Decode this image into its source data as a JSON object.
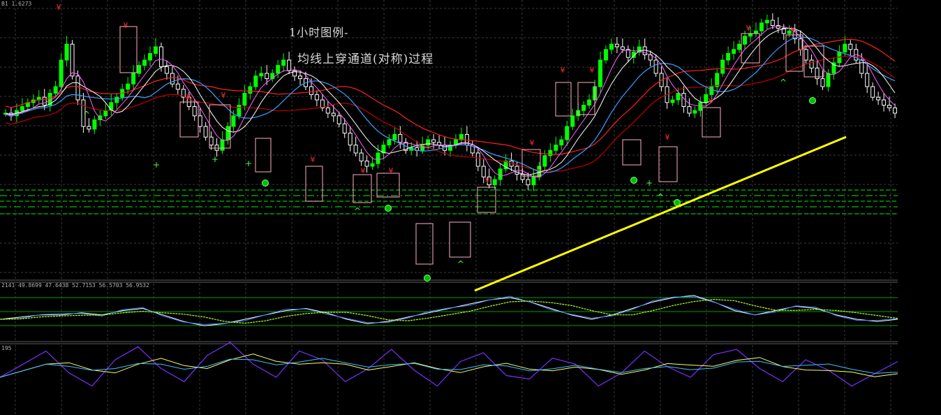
{
  "annotations": {
    "title": "1小时图例-",
    "subtitle": "均线上穿通道(对称)过程"
  },
  "panel_readouts": {
    "main": "B1 1.6273",
    "osc1": "2141 49.8699 47.6438 52.7153 56.5703 56.9532",
    "osc2": "195"
  },
  "colors": {
    "background": "#000000",
    "grid": "#3a3a3a",
    "bull": "#00ff00",
    "bear": "#ffffff",
    "ma_red": "#ff2020",
    "ma_dark_red": "#c00000",
    "ma_blue": "#3aa0ff",
    "ma_white": "#ffffff",
    "ma_pink": "#ff60ff",
    "ma_yellow": "#ffff60",
    "level_green": "#00c000",
    "trendline": "#ffff00",
    "osc_purple": "#7a30ff",
    "osc_yellow": "#ffff66",
    "osc_cyan": "#40c0ff"
  },
  "chart_data": [
    {
      "type": "candlestick",
      "panel": "price",
      "x": [
        0,
        1,
        2,
        3,
        4,
        5,
        6,
        7,
        8,
        9,
        10,
        11,
        12,
        13,
        14,
        15,
        16,
        17,
        18,
        19,
        20,
        21,
        22,
        23,
        24,
        25,
        26,
        27,
        28,
        29,
        30,
        31,
        32,
        33,
        34,
        35,
        36,
        37,
        38,
        39,
        40,
        41,
        42,
        43,
        44,
        45,
        46,
        47,
        48,
        49,
        50,
        51,
        52,
        53,
        54,
        55,
        56,
        57,
        58,
        59,
        60,
        61,
        62,
        63,
        64,
        65,
        66,
        67,
        68,
        69,
        70,
        71,
        72,
        73,
        74,
        75,
        76,
        77,
        78,
        79,
        80,
        81,
        82,
        83,
        84,
        85,
        86,
        87,
        88,
        89,
        90,
        91,
        92,
        93,
        94,
        95,
        96,
        97,
        98,
        99,
        100,
        101,
        102,
        103,
        104,
        105,
        106,
        107,
        108,
        109,
        110,
        111,
        112,
        113,
        114,
        115,
        116,
        117,
        118,
        119,
        120,
        121,
        122,
        123,
        124,
        125,
        126,
        127,
        128,
        129,
        130,
        131,
        132,
        133,
        134,
        135,
        136,
        137,
        138,
        139,
        140,
        141,
        142,
        143,
        144,
        145,
        146,
        147,
        148,
        149,
        150,
        151,
        152,
        153,
        154,
        155,
        156,
        157,
        158,
        159,
        160
      ],
      "close": [
        120,
        118,
        122,
        125,
        128,
        130,
        132,
        126,
        135,
        140,
        160,
        172,
        148,
        130,
        110,
        108,
        115,
        118,
        122,
        128,
        132,
        138,
        142,
        150,
        156,
        160,
        165,
        170,
        155,
        150,
        142,
        138,
        132,
        125,
        118,
        110,
        102,
        96,
        92,
        100,
        110,
        118,
        126,
        135,
        140,
        148,
        150,
        146,
        150,
        156,
        160,
        152,
        148,
        146,
        140,
        134,
        130,
        124,
        120,
        118,
        112,
        105,
        96,
        90,
        84,
        80,
        82,
        90,
        96,
        100,
        104,
        98,
        92,
        94,
        92,
        96,
        100,
        98,
        96,
        92,
        96,
        100,
        104,
        96,
        90,
        80,
        72,
        66,
        70,
        78,
        84,
        80,
        74,
        70,
        66,
        72,
        80,
        88,
        92,
        96,
        100,
        110,
        118,
        122,
        126,
        130,
        140,
        160,
        168,
        172,
        170,
        168,
        162,
        166,
        170,
        164,
        160,
        150,
        140,
        128,
        130,
        135,
        125,
        120,
        122,
        128,
        134,
        140,
        150,
        160,
        165,
        168,
        172,
        178,
        180,
        182,
        188,
        190,
        186,
        184,
        180,
        182,
        176,
        168,
        160,
        154,
        146,
        140,
        150,
        158,
        166,
        172,
        168,
        160,
        150,
        140,
        132,
        130,
        126,
        124,
        120
      ]
    },
    {
      "type": "line",
      "panel": "oscillator-1",
      "series": [
        {
          "values": [
            50,
            51,
            52,
            52,
            53,
            52,
            54,
            55,
            52,
            49,
            47,
            48,
            50,
            52,
            54,
            55,
            53,
            50,
            48,
            49,
            51,
            53,
            55,
            57,
            59,
            60,
            58,
            55,
            52,
            50,
            52,
            55,
            58,
            60,
            61,
            58,
            54,
            52,
            54,
            56,
            55,
            52,
            50,
            49,
            50
          ]
        }
      ]
    },
    {
      "type": "line",
      "panel": "oscillator-2",
      "series": [
        {
          "values": [
            40,
            55,
            70,
            45,
            30,
            60,
            75,
            50,
            35,
            65,
            80,
            55,
            40,
            70,
            60,
            35,
            50,
            72,
            48,
            30,
            58,
            68,
            42,
            38,
            62,
            55,
            30,
            45,
            70,
            52,
            40,
            66,
            72,
            50,
            35,
            60,
            48,
            30,
            44,
            58
          ]
        }
      ]
    }
  ]
}
